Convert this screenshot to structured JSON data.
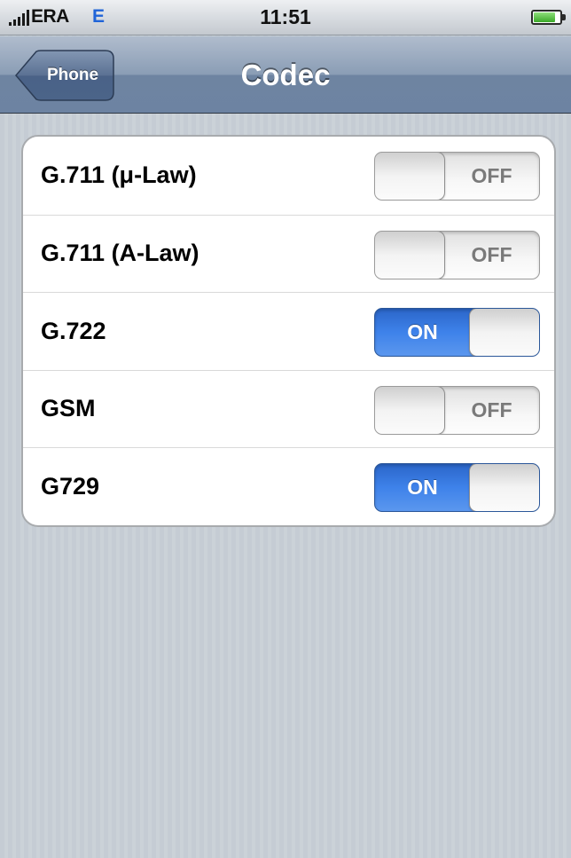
{
  "status_bar": {
    "carrier": "ERA",
    "network": "E",
    "time": "11:51"
  },
  "nav": {
    "back_label": "Phone",
    "title": "Codec"
  },
  "codecs": [
    {
      "label": "G.711 (μ-Law)",
      "enabled": false,
      "state_text": "OFF"
    },
    {
      "label": "G.711 (A-Law)",
      "enabled": false,
      "state_text": "OFF"
    },
    {
      "label": "G.722",
      "enabled": true,
      "state_text": "ON"
    },
    {
      "label": "GSM",
      "enabled": false,
      "state_text": "OFF"
    },
    {
      "label": "G729",
      "enabled": true,
      "state_text": "ON"
    }
  ],
  "colors": {
    "switch_on": "#3e82ea",
    "nav_bar": "#6d83a2",
    "background": "#c5ccd4"
  }
}
